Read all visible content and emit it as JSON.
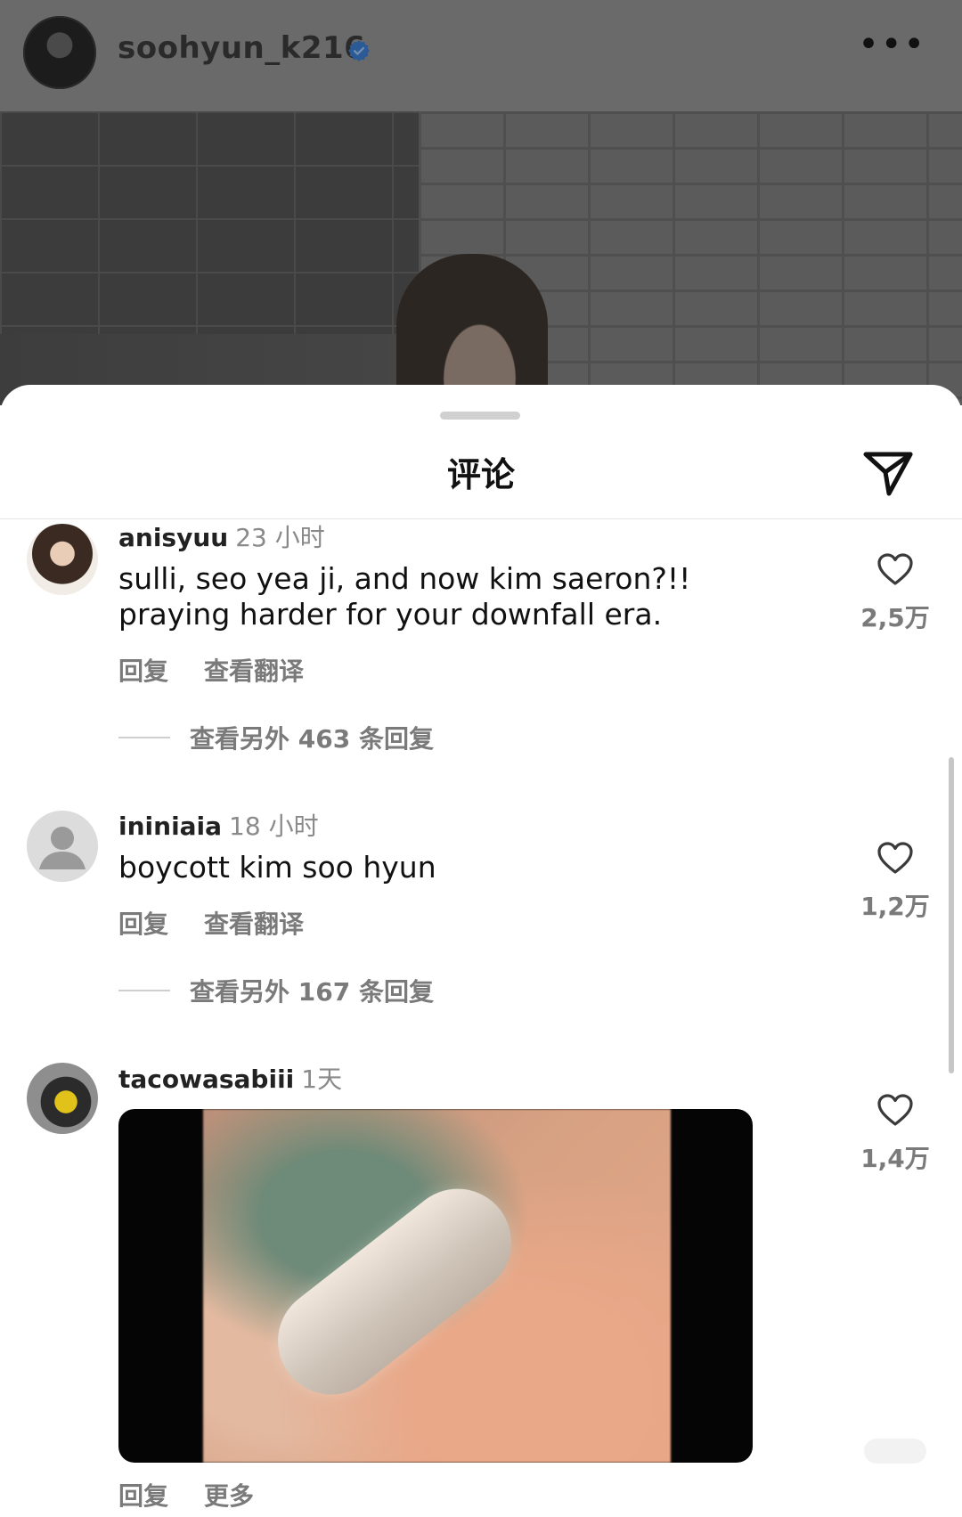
{
  "header": {
    "username": "soohyun_k216",
    "verified": true,
    "more_label": "•••",
    "icons": [
      "avatar",
      "verified-badge-icon",
      "more-options-icon"
    ]
  },
  "sheet": {
    "title": "评论",
    "share_icon": "paper-plane-icon"
  },
  "comments": [
    {
      "user": "anisyuu",
      "time": "23 小时",
      "text": "sulli, seo yea ji, and now kim saeron?!! praying harder for your downfall era.",
      "actions": [
        "回复",
        "查看翻译"
      ],
      "view_replies": "查看另外 463 条回复",
      "likes": "2,5万"
    },
    {
      "user": "ininiaia",
      "time": "18 小时",
      "text": "boycott kim soo hyun",
      "actions": [
        "回复",
        "查看翻译"
      ],
      "view_replies": "查看另外 167 条回复",
      "likes": "1,2万"
    },
    {
      "user": "tacowasabiii",
      "time": "1天",
      "text": "",
      "actions": [
        "回复",
        "更多"
      ],
      "likes": "1,4万"
    }
  ],
  "colors": {
    "header_bg": "#6a6a6a",
    "sheet_bg": "#ffffff",
    "muted_text": "#7a7a7a",
    "verified_blue": "#2b6ec2"
  }
}
